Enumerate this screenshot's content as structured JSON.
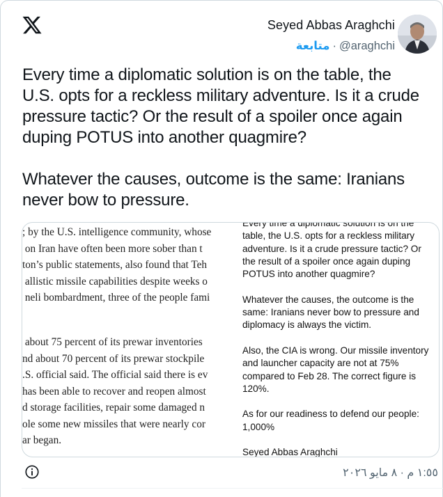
{
  "author": {
    "display_name": "Seyed Abbas Araghchi",
    "handle": "@araghchi",
    "follow_label": "متابعة"
  },
  "tweet": {
    "text": "Every time a diplomatic solution is on the table, the\nU.S. opts for a reckless military adventure. Is it a crude\npressure tactic? Or the result of a spoiler once again\nduping POTUS into another quagmire?\n\nWhatever the causes, outcome is the same: Iranians\nnever bow to pressure."
  },
  "media": {
    "article_block1": [
      "; by the U.S. intelligence community, whose",
      " on Iran have often been more sober than t",
      "ton’s public statements, also found that Teh",
      " allistic missile capabilities despite weeks o",
      " neli bombardment, three of the people fami"
    ],
    "article_block2": [
      " about 75 percent of its prewar inventories",
      "nd about 70 percent of its prewar stockpile",
      ".S. official said. The official said there is ev",
      "has been able to recover and reopen almost",
      "d storage facilities, repair some damaged n",
      "ole some new missiles that were nearly cor",
      "ar began."
    ],
    "statement_paragraphs": [
      "Every time a diplomatic solution is on the table, the U.S. opts for a reckless military adventure. Is it a crude pressure tactic? Or the result of a spoiler once again duping POTUS into another quagmire?",
      "Whatever the causes, the outcome is the same: Iranians never bow to pressure and diplomacy is always the victim.",
      "Also, the CIA is wrong. Our missile inventory and launcher capacity are not at 75% compared to Feb 28. The correct figure is 120%.",
      "As for our readiness to defend our people: 1,000%",
      "Seyed Abbas Araghchi"
    ]
  },
  "footer": {
    "timestamp": "١:٥٥ م · ٨ مايو ٢٠٢٦"
  },
  "icons": {
    "logo": "x-logo-icon",
    "info": "info-icon"
  },
  "colors": {
    "link": "#1d9bf0",
    "muted": "#536471",
    "text": "#0f1419",
    "border": "#cfd9de"
  }
}
